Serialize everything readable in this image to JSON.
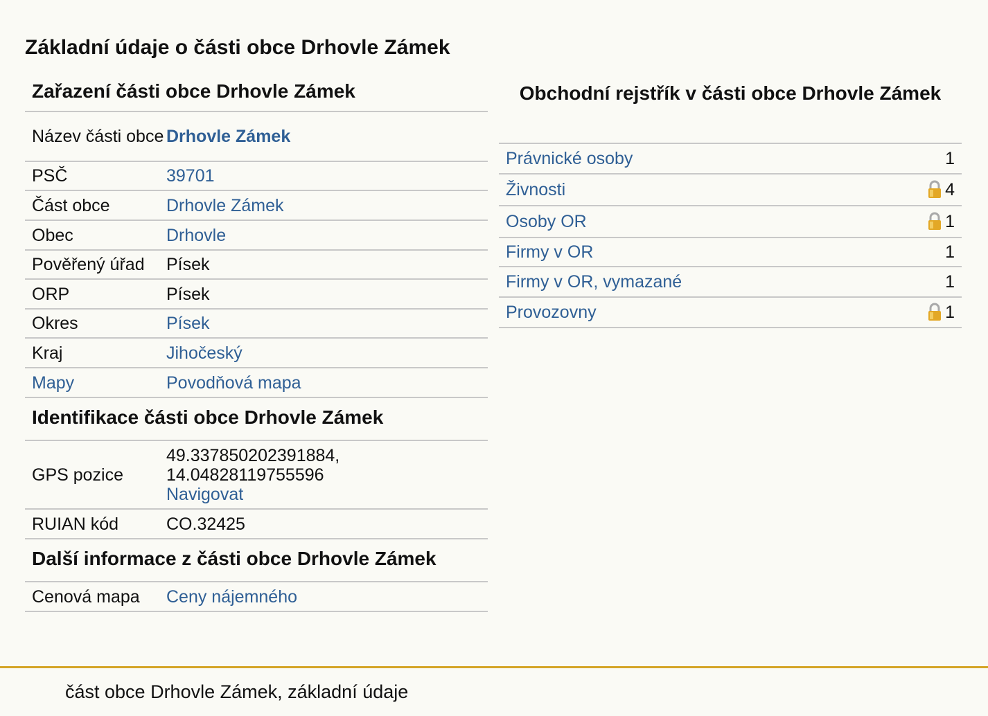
{
  "page_title": "Základní údaje o části obce Drhovle Zámek",
  "zarazeni": {
    "heading": "Zařazení části obce Drhovle Zámek",
    "rows": [
      {
        "label": "Název části obce",
        "value": "Drhovle Zámek",
        "value_link": true,
        "value_bold": true
      },
      {
        "label": "PSČ",
        "value": "39701",
        "value_link": true
      },
      {
        "label": "Část obce",
        "value": "Drhovle Zámek",
        "value_link": true
      },
      {
        "label": "Obec",
        "value": "Drhovle",
        "value_link": true
      },
      {
        "label": "Pověřený úřad",
        "value": "Písek",
        "value_link": false
      },
      {
        "label": "ORP",
        "value": "Písek",
        "value_link": false
      },
      {
        "label": "Okres",
        "value": "Písek",
        "value_link": true
      },
      {
        "label": "Kraj",
        "value": "Jihočeský",
        "value_link": true
      },
      {
        "label": "Mapy",
        "label_link": true,
        "value": "Povodňová mapa",
        "value_link": true
      }
    ]
  },
  "identifikace": {
    "heading": "Identifikace části obce Drhovle Zámek",
    "gps_label": "GPS pozice",
    "gps_lat": "49.337850202391884,",
    "gps_lon": "14.04828119755596",
    "navigate_label": "Navigovat",
    "ruian_label": "RUIAN kód",
    "ruian_value": "CO.32425"
  },
  "dalsi": {
    "heading": "Další informace z části obce Drhovle Zámek",
    "label": "Cenová mapa",
    "value": "Ceny nájemného"
  },
  "obchodni": {
    "heading": "Obchodní rejstřík v části obce Drhovle Zámek",
    "rows": [
      {
        "label": "Právnické osoby",
        "count": "1",
        "locked": false
      },
      {
        "label": "Živnosti",
        "count": "4",
        "locked": true
      },
      {
        "label": "Osoby OR",
        "count": "1",
        "locked": true
      },
      {
        "label": "Firmy v OR",
        "count": "1",
        "locked": false
      },
      {
        "label": "Firmy v OR, vymazané",
        "count": "1",
        "locked": false
      },
      {
        "label": "Provozovny",
        "count": "1",
        "locked": true
      }
    ]
  },
  "footer": {
    "text": "část obce Drhovle Zámek, základní údaje",
    "accent_color": "#d4a528"
  },
  "colors": {
    "link": "#2f5f95",
    "background": "#fafaf5",
    "lock_body": "#e3a826"
  }
}
